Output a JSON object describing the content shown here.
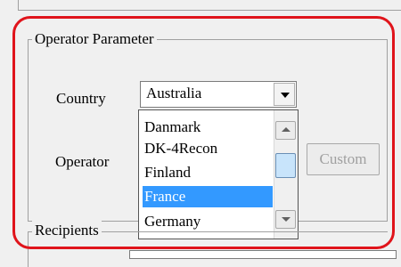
{
  "group": {
    "title": "Operator Parameter"
  },
  "country": {
    "label": "Country",
    "selected": "Australia"
  },
  "operator": {
    "label": "Operator"
  },
  "dropdown": {
    "items": [
      "Danmark",
      "DK-4Recon",
      "Finland",
      "France",
      "Germany"
    ],
    "highlighted": "France"
  },
  "buttons": {
    "custom": "Custom"
  },
  "recipients": {
    "title": "Recipients"
  },
  "colors": {
    "highlight_ring": "#e0141b",
    "selection": "#3399ff"
  }
}
